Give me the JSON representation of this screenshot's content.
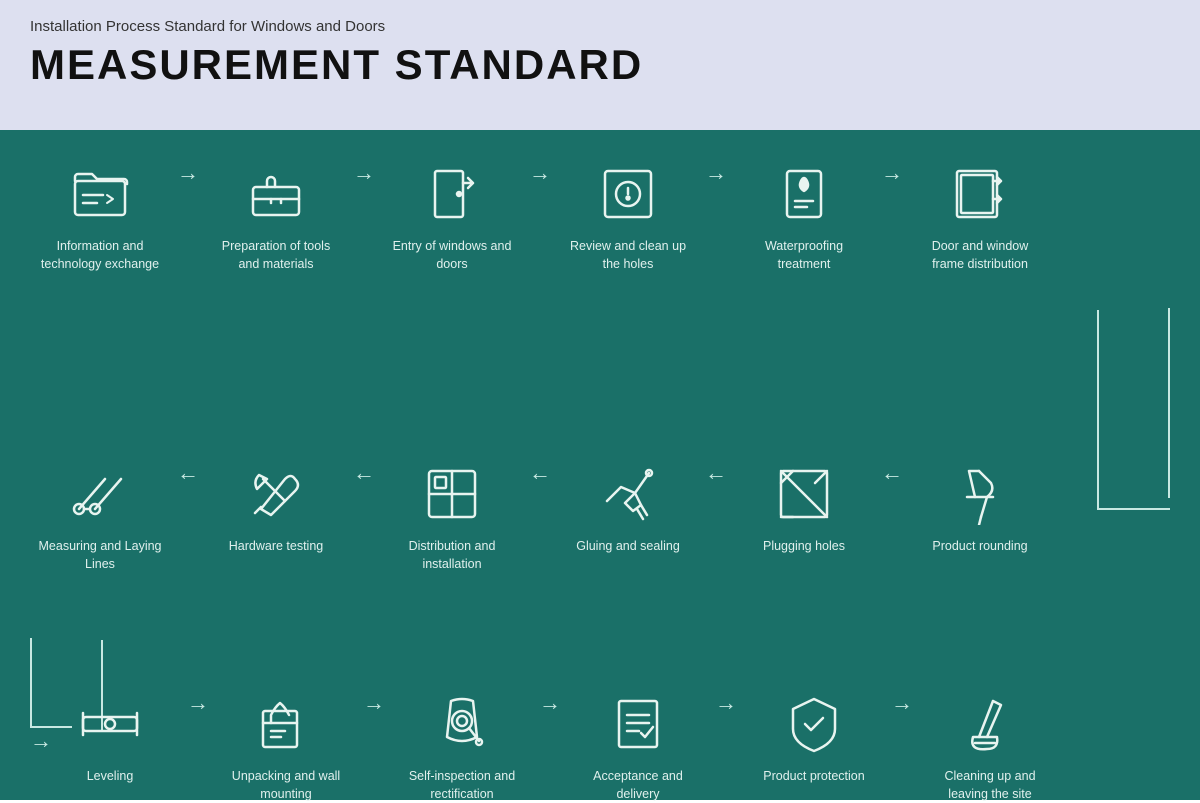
{
  "header": {
    "subtitle": "Installation Process Standard for Windows and Doors",
    "title": "MEASUREMENT STANDARD"
  },
  "row1": [
    {
      "id": "info-tech",
      "label": "Information and technology exchange",
      "icon": "folder"
    },
    {
      "id": "prep-tools",
      "label": "Preparation of tools and materials",
      "icon": "toolbox"
    },
    {
      "id": "entry-windows",
      "label": "Entry of windows and doors",
      "icon": "door-entry"
    },
    {
      "id": "review-holes",
      "label": "Review and clean up the holes",
      "icon": "search-inspect"
    },
    {
      "id": "waterproofing",
      "label": "Waterproofing treatment",
      "icon": "waterproof"
    },
    {
      "id": "frame-dist",
      "label": "Door and window frame distribution",
      "icon": "frame-export"
    }
  ],
  "row2": [
    {
      "id": "measuring",
      "label": "Measuring and Laying Lines",
      "icon": "measure-scissors"
    },
    {
      "id": "hardware",
      "label": "Hardware testing",
      "icon": "wrench-screwdriver"
    },
    {
      "id": "distribution",
      "label": "Distribution and installation",
      "icon": "grid-install"
    },
    {
      "id": "gluing",
      "label": "Gluing and sealing",
      "icon": "glue-gun"
    },
    {
      "id": "plugging",
      "label": "Plugging holes",
      "icon": "plug-holes"
    },
    {
      "id": "rounding",
      "label": "Product rounding",
      "icon": "thumbtack"
    }
  ],
  "row3": [
    {
      "id": "leveling",
      "label": "Leveling",
      "icon": "level"
    },
    {
      "id": "unpacking",
      "label": "Unpacking and wall mounting",
      "icon": "unpack-mount"
    },
    {
      "id": "self-inspect",
      "label": "Self-inspection and rectification",
      "icon": "self-inspect"
    },
    {
      "id": "acceptance",
      "label": "Acceptance and delivery",
      "icon": "accept-deliver"
    },
    {
      "id": "protection",
      "label": "Product protection",
      "icon": "shield-check"
    },
    {
      "id": "cleanup",
      "label": "Cleaning up and leaving the site",
      "icon": "broom-cleanup"
    }
  ],
  "colors": {
    "background": "#1a7068",
    "header_bg": "#dde0f0",
    "icon_stroke": "#e8f4f0",
    "arrow": "#c8e8e2",
    "text": "#e0f0ed"
  }
}
